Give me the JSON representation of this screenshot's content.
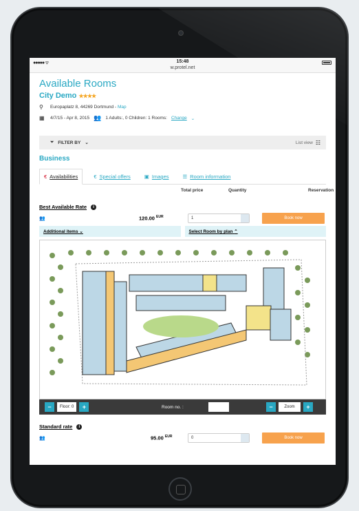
{
  "status": {
    "signal": "●●●●● ᯤ",
    "time": "15:48",
    "url": "w.protel.net"
  },
  "page": {
    "title": "Available Rooms",
    "hotel_name": "City Demo",
    "stars": "★★★★",
    "address": "Europaplatz 8, 44269 Dortmund",
    "address_sep": " - ",
    "map_link": "Map",
    "dates": "4/7/15 - Apr 8, 2015",
    "guests": "1 Adults:, 0 Children: 1 Rooms:",
    "change_link": "Change",
    "filter_label": "FILTER BY",
    "list_view": "List view",
    "section": "Business"
  },
  "tabs": [
    {
      "label": "Availabilities",
      "icon": "€"
    },
    {
      "label": "Special offers",
      "icon": "€"
    },
    {
      "label": "Images",
      "icon": "▣"
    },
    {
      "label": "Room information",
      "icon": "☰"
    }
  ],
  "table_headers": {
    "total_price": "Total price",
    "quantity": "Quantity",
    "reservation": "Reservation"
  },
  "rates": [
    {
      "name": "Best Available Rate",
      "price": "120.00",
      "currency": "EUR",
      "quantity": "1",
      "book": "Book now"
    },
    {
      "name": "Standard rate",
      "price": "95.00",
      "currency": "EUR",
      "quantity": "0",
      "book": "Book now"
    }
  ],
  "expanders": {
    "additional": "Additional items",
    "select_room": "Select Room by plan"
  },
  "plan_controls": {
    "floor": "Floor: 0",
    "room_no": "Room no. :",
    "zoom": "Zoom",
    "minus": "−",
    "plus": "+"
  },
  "colors": {
    "accent": "#29a8c3",
    "book": "#f7a24d",
    "light": "#dff3f7"
  }
}
